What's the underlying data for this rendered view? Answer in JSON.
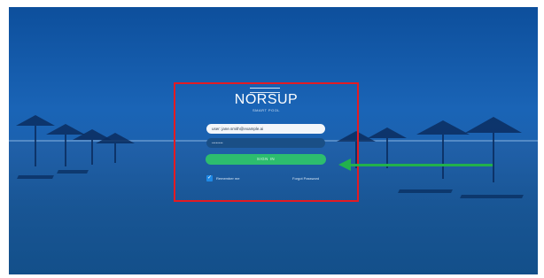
{
  "login": {
    "logo_text": "NORSUP",
    "logo_subtitle": "SMART POOL",
    "username_value": "user: jane.smith@example.ai",
    "password_value": "••••••••",
    "signin_label": "SIGN IN",
    "remember_label": "Remember me",
    "remember_checked": true,
    "forgot_label": "Forgot Password"
  },
  "annotations": {
    "highlight_color": "#e31b23",
    "arrow_color": "#22b14c"
  },
  "colors": {
    "background_blue": "#1a64b6",
    "button_green": "#2dbd6e"
  }
}
